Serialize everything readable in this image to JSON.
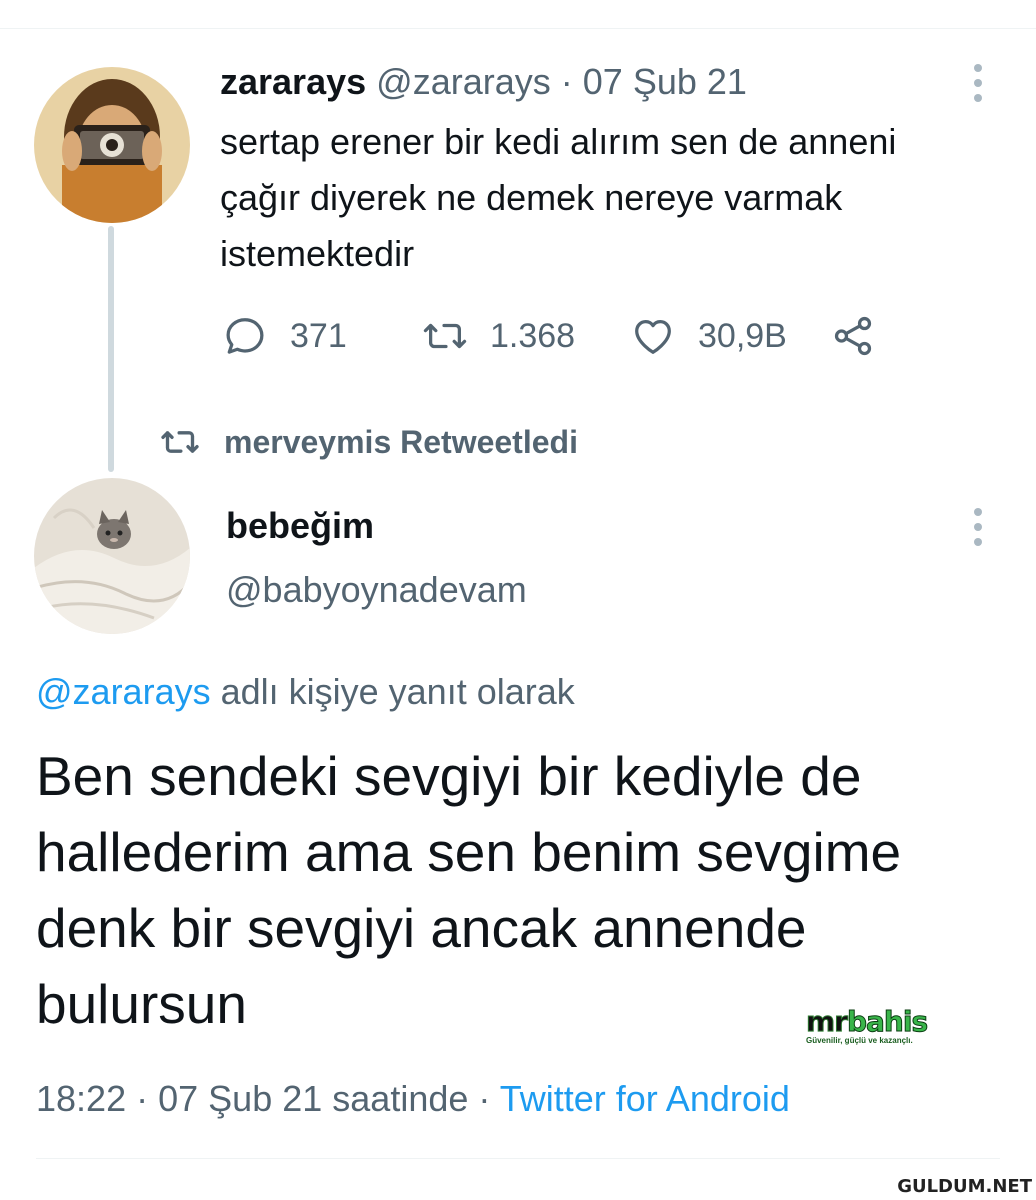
{
  "tweet1": {
    "display_name": "zararays",
    "handle": "@zararays",
    "separator": "·",
    "date": "07 Şub 21",
    "text": "sertap erener bir kedi alırım sen de anneni çağır diyerek ne demek nereye varmak istemektedir",
    "replies": "371",
    "retweets": "1.368",
    "likes": "30,9B"
  },
  "retweet_banner": {
    "text": "merveymis Retweetledi"
  },
  "tweet2": {
    "display_name": "bebeğim",
    "handle": "@babyoynadevam",
    "reply_to_handle": "@zararays",
    "reply_to_suffix": " adlı kişiye yanıt olarak",
    "text": "Ben sendeki sevgiyi bir kediyle de hallederim ama sen benim sevgime denk bir sevgiyi ancak annende bulursun",
    "time": "18:22",
    "date_suffix": "07 Şub 21 saatinde",
    "separator": "·",
    "source": "Twitter for Android"
  },
  "watermarks": {
    "logo_mr": "mr",
    "logo_bahis": "bahis",
    "tagline": "Güvenilir, güçlü ve kazançlı.",
    "site": "GULDUM.NET"
  },
  "icons": [
    "more-icon",
    "reply-icon",
    "retweet-icon",
    "like-icon",
    "share-icon"
  ],
  "colors": {
    "link": "#1d9bf0",
    "muted": "#536471",
    "text": "#0f1419",
    "thread_line": "#cfd9de"
  }
}
